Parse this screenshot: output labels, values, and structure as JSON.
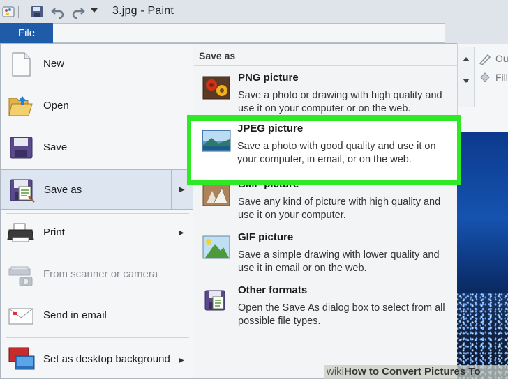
{
  "window": {
    "title": "3.jpg - Paint"
  },
  "ribbon": {
    "file_tab": "File",
    "right_items": [
      "Ou",
      "Fill"
    ]
  },
  "file_menu": {
    "items": [
      {
        "label": "New",
        "icon": "new-document-icon",
        "disabled": false,
        "submenu": false
      },
      {
        "label": "Open",
        "icon": "open-folder-icon",
        "disabled": false,
        "submenu": false
      },
      {
        "label": "Save",
        "icon": "save-disk-icon",
        "disabled": false,
        "submenu": false
      },
      {
        "label": "Save as",
        "icon": "save-as-icon",
        "disabled": false,
        "submenu": true,
        "highlighted": true
      },
      {
        "label": "Print",
        "icon": "printer-icon",
        "disabled": false,
        "submenu": true
      },
      {
        "label": "From scanner or camera",
        "icon": "scanner-icon",
        "disabled": true,
        "submenu": false
      },
      {
        "label": "Send in email",
        "icon": "email-icon",
        "disabled": false,
        "submenu": false
      },
      {
        "label": "Set as desktop background",
        "icon": "desktop-background-icon",
        "disabled": false,
        "submenu": true
      }
    ]
  },
  "save_as": {
    "heading": "Save as",
    "options": [
      {
        "title": "PNG picture",
        "desc": "Save a photo or drawing with high quality and use it on your computer or on the web.",
        "icon": "png-picture-icon"
      },
      {
        "title": "JPEG picture",
        "desc": "Save a photo with good quality and use it on your computer, in email, or on the web.",
        "icon": "jpeg-picture-icon",
        "highlighted": true
      },
      {
        "title": "BMP picture",
        "desc": "Save any kind of picture with high quality and use it on your computer.",
        "icon": "bmp-picture-icon"
      },
      {
        "title": "GIF picture",
        "desc": "Save a simple drawing with lower quality and use it in email or on the web.",
        "icon": "gif-picture-icon"
      },
      {
        "title": "Other formats",
        "desc": "Open the Save As dialog box to select from all possible file types.",
        "icon": "other-formats-icon"
      }
    ]
  },
  "watermark": {
    "brand": "wiki",
    "text": "How to Convert Pictures To JPEG"
  },
  "colors": {
    "file_tab": "#1e5ba8",
    "highlight_green": "#2eea24",
    "menu_bg": "#f3f4f6"
  }
}
